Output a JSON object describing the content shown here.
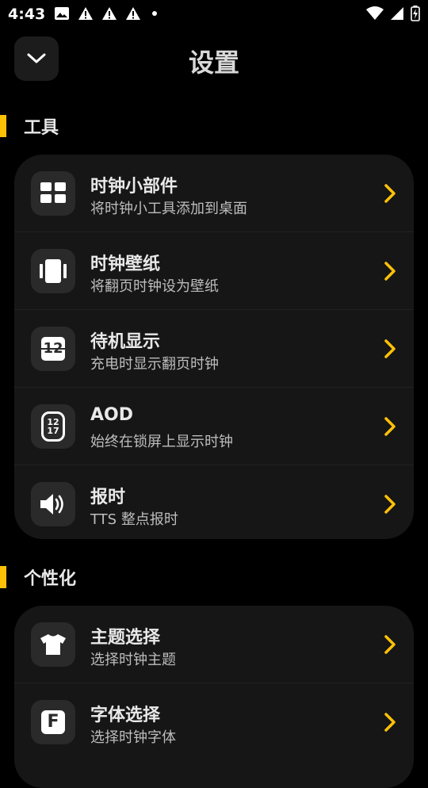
{
  "status_bar": {
    "time": "4:43"
  },
  "header": {
    "title": "设置"
  },
  "sections": [
    {
      "title": "工具",
      "items": [
        {
          "title": "时钟小部件",
          "subtitle": "将时钟小工具添加到桌面",
          "icon": "widget-grid-icon"
        },
        {
          "title": "时钟壁纸",
          "subtitle": "将翻页时钟设为壁纸",
          "icon": "wallpaper-icon"
        },
        {
          "title": "待机显示",
          "subtitle": "充电时显示翻页时钟",
          "icon": "flip-clock-12-icon",
          "icon_text": "12"
        },
        {
          "title": "AOD",
          "subtitle": "始终在锁屏上显示时钟",
          "icon": "aod-watch-icon",
          "icon_text_top": "12",
          "icon_text_bottom": "17"
        },
        {
          "title": "报时",
          "subtitle": "TTS 整点报时",
          "icon": "speaker-icon"
        }
      ]
    },
    {
      "title": "个性化",
      "items": [
        {
          "title": "主题选择",
          "subtitle": "选择时钟主题",
          "icon": "tshirt-icon"
        },
        {
          "title": "字体选择",
          "subtitle": "选择时钟字体",
          "icon": "font-icon",
          "icon_text": "F"
        }
      ]
    }
  ],
  "colors": {
    "accent": "#ffc107",
    "background": "#000000",
    "card": "#161616",
    "icon_tile": "#2a2a2a"
  }
}
